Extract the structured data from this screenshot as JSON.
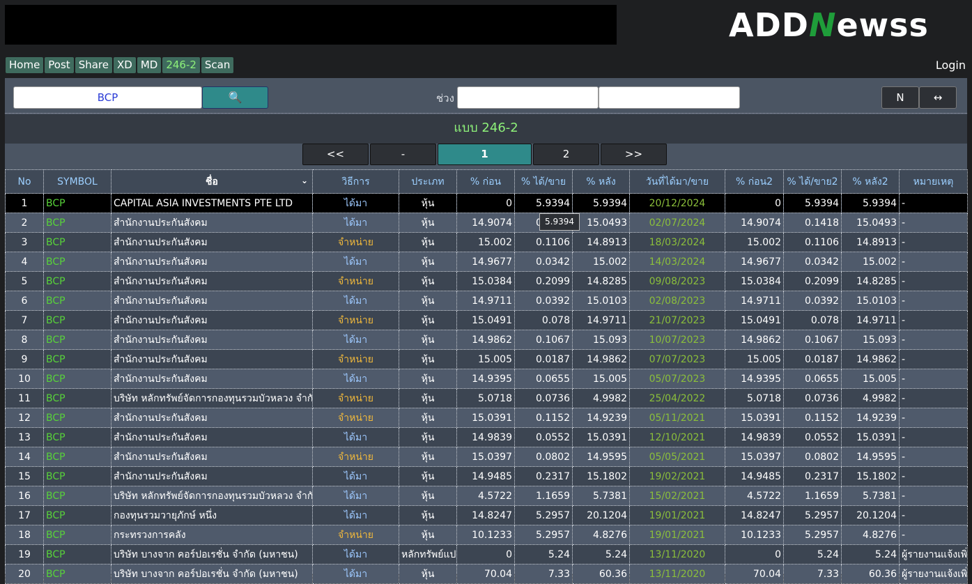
{
  "logo": {
    "pre": "ADD",
    "n": "N",
    "post": "ewss"
  },
  "nav": [
    "Home",
    "Post",
    "Share",
    "XD",
    "MD",
    "246-2",
    "Scan"
  ],
  "nav_active": "246-2",
  "login": "Login",
  "search": {
    "value": "BCP",
    "button_icon": "🔍"
  },
  "range_label": "ช่วง",
  "buttons": {
    "n": "N",
    "arrow": "↔"
  },
  "title": "แบบ 246-2",
  "pager": [
    "<<",
    "-",
    "1",
    "2",
    ">>"
  ],
  "pager_current": "1",
  "columns": [
    "No",
    "SYMBOL",
    "ชื่อ",
    "วิธีการ",
    "ประเภท",
    "% ก่อน",
    "% ได้/ขาย",
    "% หลัง",
    "วันที่ได้มา/ขาย",
    "% ก่อน2",
    "% ได้/ขาย2",
    "% หลัง2",
    "หมายเหตุ"
  ],
  "tooltip": "5.9394",
  "rows": [
    {
      "no": "1",
      "sym": "BCP",
      "name": "CAPITAL ASIA INVESTMENTS PTE LTD",
      "act": "ได้มา",
      "type": "หุ้น",
      "b": "0",
      "c": "5.9394",
      "a": "5.9394",
      "date": "20/12/2024",
      "b2": "0",
      "c2": "5.9394",
      "a2": "5.9394",
      "note": "-"
    },
    {
      "no": "2",
      "sym": "BCP",
      "name": "สำนักงานประกันสังคม",
      "act": "ได้มา",
      "type": "หุ้น",
      "b": "14.9074",
      "c": "0.1418",
      "a": "15.0493",
      "date": "02/07/2024",
      "b2": "14.9074",
      "c2": "0.1418",
      "a2": "15.0493",
      "note": "-"
    },
    {
      "no": "3",
      "sym": "BCP",
      "name": "สำนักงานประกันสังคม",
      "act": "จำหน่าย",
      "type": "หุ้น",
      "b": "15.002",
      "c": "0.1106",
      "a": "14.8913",
      "date": "18/03/2024",
      "b2": "15.002",
      "c2": "0.1106",
      "a2": "14.8913",
      "note": "-"
    },
    {
      "no": "4",
      "sym": "BCP",
      "name": "สำนักงานประกันสังคม",
      "act": "ได้มา",
      "type": "หุ้น",
      "b": "14.9677",
      "c": "0.0342",
      "a": "15.002",
      "date": "14/03/2024",
      "b2": "14.9677",
      "c2": "0.0342",
      "a2": "15.002",
      "note": "-"
    },
    {
      "no": "5",
      "sym": "BCP",
      "name": "สำนักงานประกันสังคม",
      "act": "จำหน่าย",
      "type": "หุ้น",
      "b": "15.0384",
      "c": "0.2099",
      "a": "14.8285",
      "date": "09/08/2023",
      "b2": "15.0384",
      "c2": "0.2099",
      "a2": "14.8285",
      "note": "-"
    },
    {
      "no": "6",
      "sym": "BCP",
      "name": "สำนักงานประกันสังคม",
      "act": "ได้มา",
      "type": "หุ้น",
      "b": "14.9711",
      "c": "0.0392",
      "a": "15.0103",
      "date": "02/08/2023",
      "b2": "14.9711",
      "c2": "0.0392",
      "a2": "15.0103",
      "note": "-"
    },
    {
      "no": "7",
      "sym": "BCP",
      "name": "สำนักงานประกันสังคม",
      "act": "จำหน่าย",
      "type": "หุ้น",
      "b": "15.0491",
      "c": "0.078",
      "a": "14.9711",
      "date": "21/07/2023",
      "b2": "15.0491",
      "c2": "0.078",
      "a2": "14.9711",
      "note": "-"
    },
    {
      "no": "8",
      "sym": "BCP",
      "name": "สำนักงานประกันสังคม",
      "act": "ได้มา",
      "type": "หุ้น",
      "b": "14.9862",
      "c": "0.1067",
      "a": "15.093",
      "date": "10/07/2023",
      "b2": "14.9862",
      "c2": "0.1067",
      "a2": "15.093",
      "note": "-"
    },
    {
      "no": "9",
      "sym": "BCP",
      "name": "สำนักงานประกันสังคม",
      "act": "จำหน่าย",
      "type": "หุ้น",
      "b": "15.005",
      "c": "0.0187",
      "a": "14.9862",
      "date": "07/07/2023",
      "b2": "15.005",
      "c2": "0.0187",
      "a2": "14.9862",
      "note": "-"
    },
    {
      "no": "10",
      "sym": "BCP",
      "name": "สำนักงานประกันสังคม",
      "act": "ได้มา",
      "type": "หุ้น",
      "b": "14.9395",
      "c": "0.0655",
      "a": "15.005",
      "date": "05/07/2023",
      "b2": "14.9395",
      "c2": "0.0655",
      "a2": "15.005",
      "note": "-"
    },
    {
      "no": "11",
      "sym": "BCP",
      "name": "บริษัท หลักทรัพย์จัดการกองทุนรวมบัวหลวง จำกัด",
      "act": "จำหน่าย",
      "type": "หุ้น",
      "b": "5.0718",
      "c": "0.0736",
      "a": "4.9982",
      "date": "25/04/2022",
      "b2": "5.0718",
      "c2": "0.0736",
      "a2": "4.9982",
      "note": "-"
    },
    {
      "no": "12",
      "sym": "BCP",
      "name": "สำนักงานประกันสังคม",
      "act": "จำหน่าย",
      "type": "หุ้น",
      "b": "15.0391",
      "c": "0.1152",
      "a": "14.9239",
      "date": "05/11/2021",
      "b2": "15.0391",
      "c2": "0.1152",
      "a2": "14.9239",
      "note": "-"
    },
    {
      "no": "13",
      "sym": "BCP",
      "name": "สำนักงานประกันสังคม",
      "act": "ได้มา",
      "type": "หุ้น",
      "b": "14.9839",
      "c": "0.0552",
      "a": "15.0391",
      "date": "12/10/2021",
      "b2": "14.9839",
      "c2": "0.0552",
      "a2": "15.0391",
      "note": "-"
    },
    {
      "no": "14",
      "sym": "BCP",
      "name": "สำนักงานประกันสังคม",
      "act": "จำหน่าย",
      "type": "หุ้น",
      "b": "15.0397",
      "c": "0.0802",
      "a": "14.9595",
      "date": "05/05/2021",
      "b2": "15.0397",
      "c2": "0.0802",
      "a2": "14.9595",
      "note": "-"
    },
    {
      "no": "15",
      "sym": "BCP",
      "name": "สำนักงานประกันสังคม",
      "act": "ได้มา",
      "type": "หุ้น",
      "b": "14.9485",
      "c": "0.2317",
      "a": "15.1802",
      "date": "19/02/2021",
      "b2": "14.9485",
      "c2": "0.2317",
      "a2": "15.1802",
      "note": "-"
    },
    {
      "no": "16",
      "sym": "BCP",
      "name": "บริษัท หลักทรัพย์จัดการกองทุนรวมบัวหลวง จำกัด",
      "act": "ได้มา",
      "type": "หุ้น",
      "b": "4.5722",
      "c": "1.1659",
      "a": "5.7381",
      "date": "15/02/2021",
      "b2": "4.5722",
      "c2": "1.1659",
      "a2": "5.7381",
      "note": "-"
    },
    {
      "no": "17",
      "sym": "BCP",
      "name": "กองทุนรวมวายุภักษ์ หนึ่ง",
      "act": "ได้มา",
      "type": "หุ้น",
      "b": "14.8247",
      "c": "5.2957",
      "a": "20.1204",
      "date": "19/01/2021",
      "b2": "14.8247",
      "c2": "5.2957",
      "a2": "20.1204",
      "note": "-"
    },
    {
      "no": "18",
      "sym": "BCP",
      "name": "กระทรวงการคลัง",
      "act": "จำหน่าย",
      "type": "หุ้น",
      "b": "10.1233",
      "c": "5.2957",
      "a": "4.8276",
      "date": "19/01/2021",
      "b2": "10.1233",
      "c2": "5.2957",
      "a2": "4.8276",
      "note": "-"
    },
    {
      "no": "19",
      "sym": "BCP",
      "name": "บริษัท บางจาก คอร์ปอเรชั่น จำกัด (มหาชน)",
      "act": "ได้มา",
      "type": "หลักทรัพย์แปลงสภาพ",
      "b": "0",
      "c": "5.24",
      "a": "5.24",
      "date": "13/11/2020",
      "b2": "0",
      "c2": "5.24",
      "a2": "5.24",
      "note": "ผู้รายงานแจ้งเพิ่มเติม"
    },
    {
      "no": "20",
      "sym": "BCP",
      "name": "บริษัท บางจาก คอร์ปอเรชั่น จำกัด (มหาชน)",
      "act": "ได้มา",
      "type": "หุ้น",
      "b": "70.04",
      "c": "7.33",
      "a": "60.36",
      "date": "13/11/2020",
      "b2": "70.04",
      "c2": "7.33",
      "a2": "60.36",
      "note": "ผู้รายงานแจ้งเพิ่มเติม"
    }
  ]
}
